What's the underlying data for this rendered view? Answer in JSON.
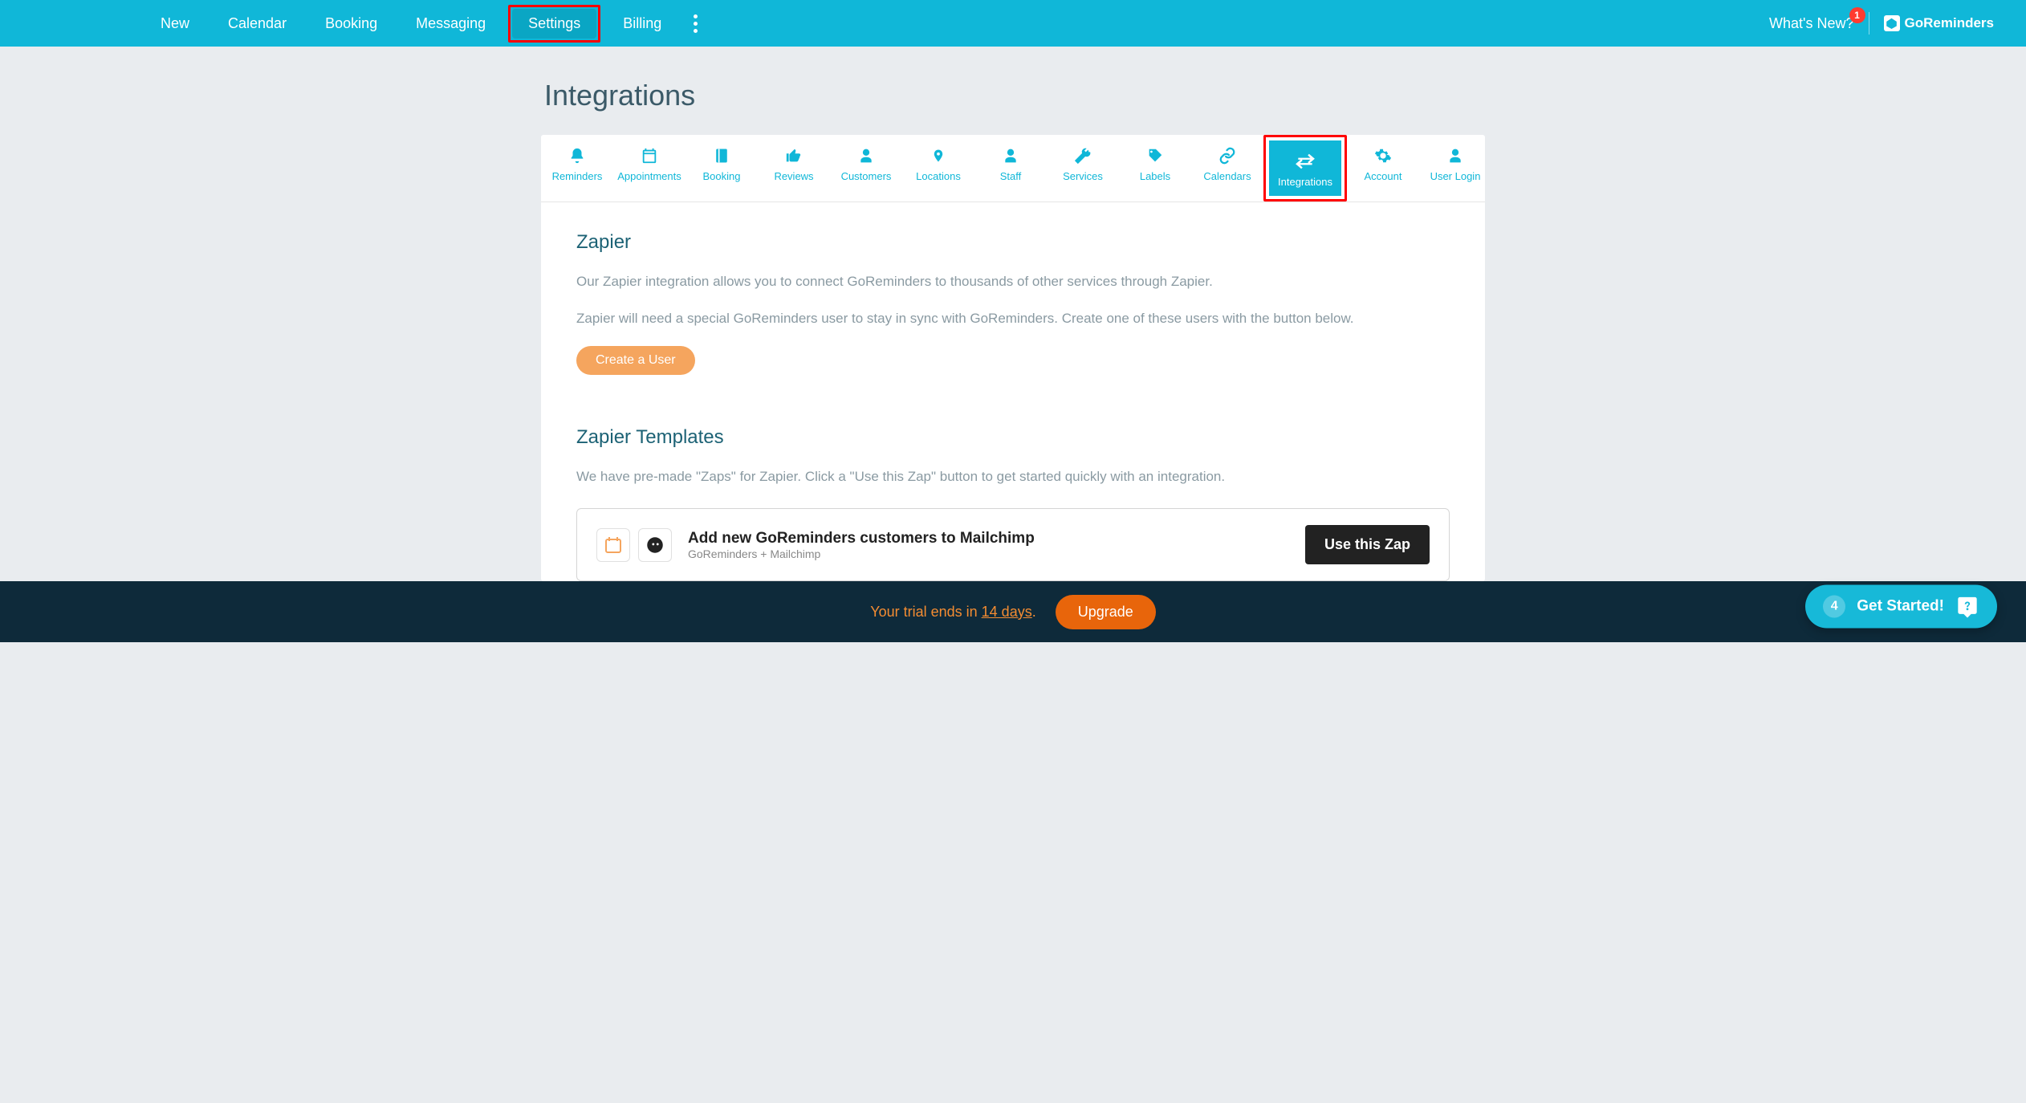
{
  "nav": {
    "items": [
      "New",
      "Calendar",
      "Booking",
      "Messaging",
      "Settings",
      "Billing"
    ],
    "active_index": 4,
    "whats_new": "What's New?",
    "whats_new_badge": "1",
    "brand": "GoReminders"
  },
  "page": {
    "title": "Integrations"
  },
  "subnav": {
    "items": [
      {
        "label": "Reminders",
        "icon": "bell"
      },
      {
        "label": "Appointments",
        "icon": "calendar"
      },
      {
        "label": "Booking",
        "icon": "book"
      },
      {
        "label": "Reviews",
        "icon": "thumbs-up"
      },
      {
        "label": "Customers",
        "icon": "person"
      },
      {
        "label": "Locations",
        "icon": "pin"
      },
      {
        "label": "Staff",
        "icon": "person"
      },
      {
        "label": "Services",
        "icon": "wrench"
      },
      {
        "label": "Labels",
        "icon": "tag"
      },
      {
        "label": "Calendars",
        "icon": "link"
      },
      {
        "label": "Integrations",
        "icon": "arrows"
      },
      {
        "label": "Account",
        "icon": "gear"
      },
      {
        "label": "User Login",
        "icon": "user"
      }
    ],
    "active_index": 10
  },
  "zapier": {
    "title": "Zapier",
    "p1": "Our Zapier integration allows you to connect GoReminders to thousands of other services through Zapier.",
    "p2": "Zapier will need a special GoReminders user to stay in sync with GoReminders. Create one of these users with the button below.",
    "create_btn": "Create a User"
  },
  "templates": {
    "title": "Zapier Templates",
    "intro": "We have pre-made \"Zaps\" for Zapier. Click a \"Use this Zap\" button to get started quickly with an integration.",
    "row": {
      "title": "Add new GoReminders customers to Mailchimp",
      "subtitle": "GoReminders + Mailchimp",
      "button": "Use this Zap"
    }
  },
  "footer": {
    "trial_prefix": "Your trial ends in ",
    "trial_days": "14 days",
    "trial_suffix": ".",
    "upgrade": "Upgrade",
    "get_started_count": "4",
    "get_started_label": "Get Started!"
  },
  "highlights": {
    "settings_box": true,
    "integrations_box": true
  },
  "icons": {
    "bell": "bell",
    "calendar": "calendar",
    "book": "book",
    "thumbs-up": "thumbs-up",
    "person": "person",
    "pin": "pin",
    "wrench": "wrench",
    "tag": "tag",
    "link": "link",
    "arrows": "arrows",
    "gear": "gear",
    "user": "user"
  }
}
